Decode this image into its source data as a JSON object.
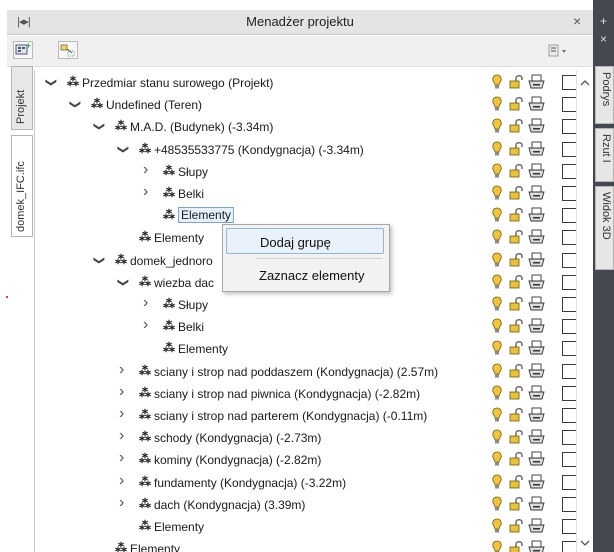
{
  "panel": {
    "title": "Menadżer projektu",
    "pin_icon": "pin-icon",
    "close_label": "×"
  },
  "left_tabs": [
    {
      "label": "Projekt",
      "active": false
    },
    {
      "label": "domek_IFC.ifc",
      "active": true
    }
  ],
  "right_tabs": [
    {
      "label": "Podrys"
    },
    {
      "label": "Rzut I"
    },
    {
      "label": "Widok 3D"
    }
  ],
  "context_menu": {
    "items": [
      {
        "label": "Dodaj grupę",
        "highlighted": true
      },
      {
        "label": "Zaznacz elementy",
        "highlighted": false
      }
    ]
  },
  "tree": [
    {
      "label": "Przedmiar stanu surowego (Projekt)",
      "level": 0,
      "expander": "expanded"
    },
    {
      "label": "Undefined (Teren)",
      "level": 1,
      "expander": "expanded"
    },
    {
      "label": "M.A.D. (Budynek) (-3.34m)",
      "level": 2,
      "expander": "expanded"
    },
    {
      "label": "+48535533775 (Kondygnacja) (-3.34m)",
      "level": 3,
      "expander": "expanded"
    },
    {
      "label": "Słupy",
      "level": 4,
      "expander": "collapsed"
    },
    {
      "label": "Belki",
      "level": 4,
      "expander": "collapsed"
    },
    {
      "label": "Elementy",
      "level": 4,
      "expander": "none",
      "selected": true
    },
    {
      "label": "Elementy",
      "level": 3,
      "expander": "none"
    },
    {
      "label": "domek_jednoro",
      "level": 2,
      "expander": "expanded"
    },
    {
      "label": "wiezba dac",
      "level": 3,
      "expander": "expanded"
    },
    {
      "label": "Słupy",
      "level": 4,
      "expander": "collapsed"
    },
    {
      "label": "Belki",
      "level": 4,
      "expander": "collapsed"
    },
    {
      "label": "Elementy",
      "level": 4,
      "expander": "none"
    },
    {
      "label": "sciany i strop nad poddaszem (Kondygnacja) (2.57m)",
      "level": 3,
      "expander": "collapsed"
    },
    {
      "label": "sciany i strop nad piwnica (Kondygnacja) (-2.82m)",
      "level": 3,
      "expander": "collapsed"
    },
    {
      "label": "sciany i strop nad parterem (Kondygnacja) (-0.11m)",
      "level": 3,
      "expander": "collapsed"
    },
    {
      "label": "schody (Kondygnacja) (-2.73m)",
      "level": 3,
      "expander": "collapsed"
    },
    {
      "label": "kominy (Kondygnacja) (-2.82m)",
      "level": 3,
      "expander": "collapsed"
    },
    {
      "label": "fundamenty (Kondygnacja) (-3.22m)",
      "level": 3,
      "expander": "collapsed"
    },
    {
      "label": "dach (Kondygnacja) (3.39m)",
      "level": 3,
      "expander": "collapsed"
    },
    {
      "label": "Elementy",
      "level": 3,
      "expander": "none"
    },
    {
      "label": "Elementy",
      "level": 2,
      "expander": "none"
    }
  ],
  "row_icons": [
    "bulb-icon",
    "lock-icon",
    "printer-icon",
    "checkbox"
  ],
  "colors": {
    "titlebar": "#e4e4e4",
    "right_strip": "#444850",
    "selection_border": "#7da2ce",
    "bulb": "#f2c43a"
  }
}
